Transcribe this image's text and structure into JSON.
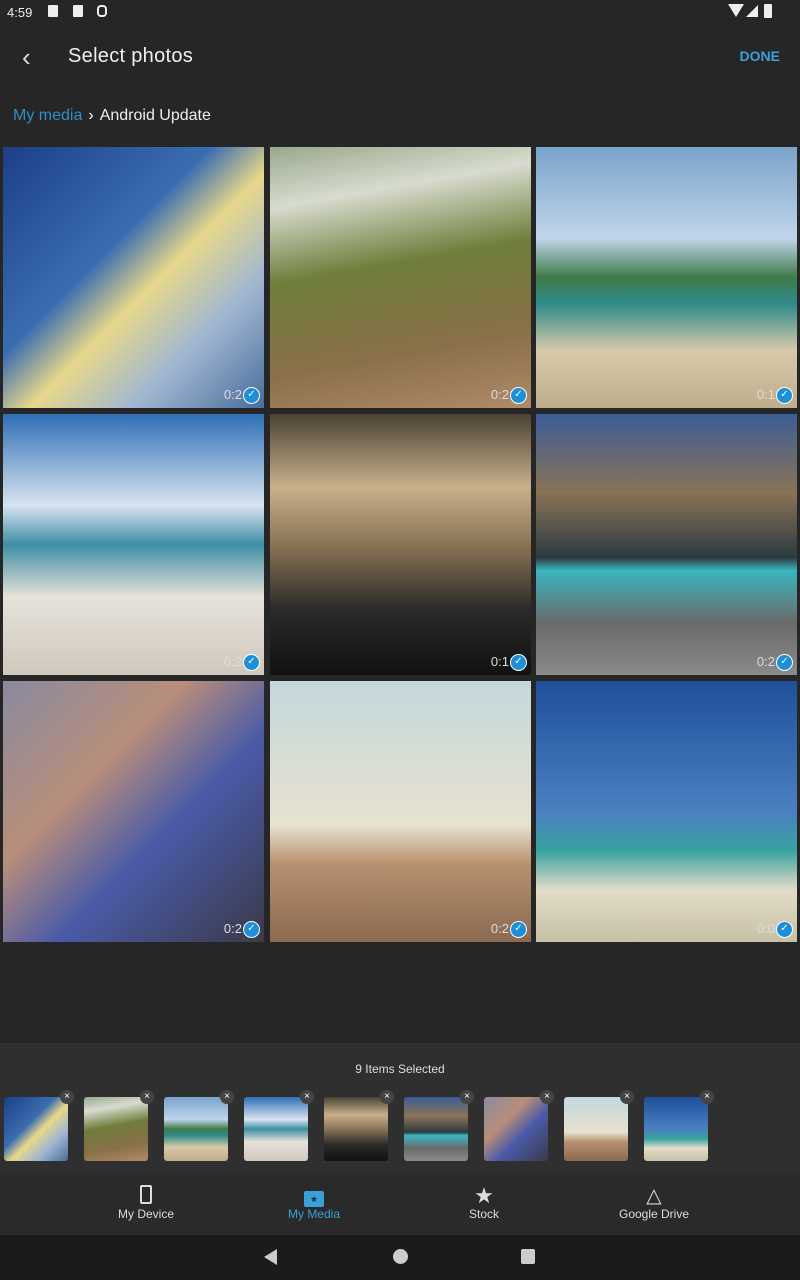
{
  "status": {
    "time": "4:59"
  },
  "appbar": {
    "title": "Select photos",
    "done": "DONE"
  },
  "breadcrumb": {
    "root": "My media",
    "current": "Android Update"
  },
  "colors": {
    "accent": "#3aa0d8",
    "check": "#1e8fd6"
  },
  "photos": [
    {
      "desc": "sun-palm-sky",
      "duration": "0:2",
      "selected": true,
      "bg": "linear-gradient(135deg,#1c3f86 0%,#3a6db0 40%,#e8d88a 55%,#9fb6d2 75%,#4a6d9a 100%)"
    },
    {
      "desc": "aerial-beach-waves",
      "duration": "0:2",
      "selected": true,
      "bg": "linear-gradient(170deg,#9aa88c 0%,#d8dccf 20%,#6f7e3c 45%,#8a7048 75%,#b08a6a 100%)"
    },
    {
      "desc": "palm-beach-island",
      "duration": "0:1",
      "selected": true,
      "bg": "linear-gradient(180deg,#7aa3cc 0%,#c0d5ea 35%,#3f7a4a 50%,#2f8a8a 60%,#d7c9a9 78%,#bfae8c 100%)"
    },
    {
      "desc": "beach-chairs-hat",
      "duration": "0:2",
      "selected": true,
      "bg": "linear-gradient(180deg,#2e6fb5 0%,#d8e4f0 35%,#3e8ea5 50%,#e6e2da 70%,#cfc8bd 100%)"
    },
    {
      "desc": "silhouette-sunset",
      "duration": "0:1",
      "selected": true,
      "bg": "linear-gradient(180deg,#4a4236 0%,#c9b08a 28%,#8a7458 50%,#2a2a28 75%,#111 100%)"
    },
    {
      "desc": "beach-hut-pier",
      "duration": "0:2",
      "selected": true,
      "bg": "linear-gradient(180deg,#3c5d96 0%,#8a7356 30%,#2c3a40 55%,#3ab5c0 60%,#6a6a6a 80%,#8a8a8a 100%)"
    },
    {
      "desc": "friends-walking-beach",
      "duration": "0:2",
      "selected": true,
      "bg": "linear-gradient(135deg,#8a8aa0 0%,#b88e7a 35%,#4a5aa8 60%,#3a3a48 100%)"
    },
    {
      "desc": "couple-bicycle-beach",
      "duration": "0:2",
      "selected": true,
      "bg": "linear-gradient(180deg,#c3d8dc 0%,#e8e2cf 55%,#b89070 70%,#8a6a50 100%)"
    },
    {
      "desc": "yoga-beach",
      "duration": "0:0",
      "selected": true,
      "bg": "linear-gradient(180deg,#1f4f9a 0%,#4a80c0 50%,#38a3a0 65%,#e2dcc8 80%,#c8c0a6 100%)"
    }
  ],
  "selection": {
    "count_label": "9 Items Selected",
    "remove_label": "×"
  },
  "tabs": [
    {
      "label": "My Device",
      "icon": "phone-icon",
      "active": false
    },
    {
      "label": "My Media",
      "icon": "folder-star-icon",
      "active": true
    },
    {
      "label": "Stock",
      "icon": "star-icon",
      "active": false
    },
    {
      "label": "Google Drive",
      "icon": "drive-icon",
      "active": false
    }
  ]
}
